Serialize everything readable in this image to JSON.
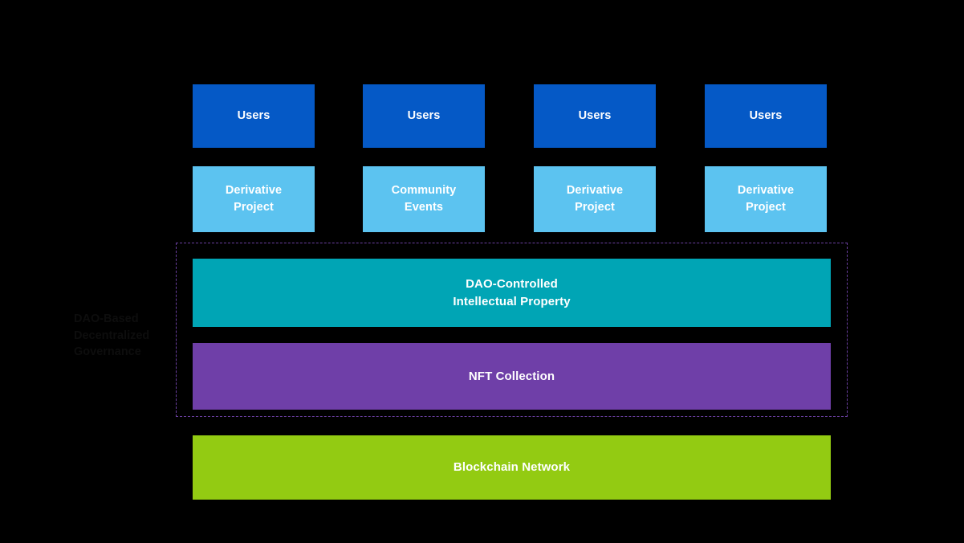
{
  "diagram": {
    "background_color": "#000000",
    "side_label": {
      "text": "DAO-Based\nDecentralized\nGovernance",
      "color": "#0d0d0d"
    },
    "dashed_region": {
      "name": "dao-governance-boundary",
      "border_color": "#6a3fa0",
      "style": "dashed"
    },
    "user_row": [
      {
        "label": "Users",
        "color": "#0559c6"
      },
      {
        "label": "Users",
        "color": "#0559c6"
      },
      {
        "label": "Users",
        "color": "#0559c6"
      },
      {
        "label": "Users",
        "color": "#0559c6"
      }
    ],
    "project_row": [
      {
        "label": "Derivative\nProject",
        "color": "#5cc3f0"
      },
      {
        "label": "Community\nEvents",
        "color": "#5cc3f0"
      },
      {
        "label": "Derivative\nProject",
        "color": "#5cc3f0"
      },
      {
        "label": "Derivative\nProject",
        "color": "#5cc3f0"
      }
    ],
    "stack_rows": [
      {
        "label": "DAO-Controlled\nIntellectual Property",
        "color": "#00a5b5"
      },
      {
        "label": "NFT Collection",
        "color": "#6f3fa8"
      },
      {
        "label": "Blockchain Network",
        "color": "#93cb12"
      }
    ]
  }
}
